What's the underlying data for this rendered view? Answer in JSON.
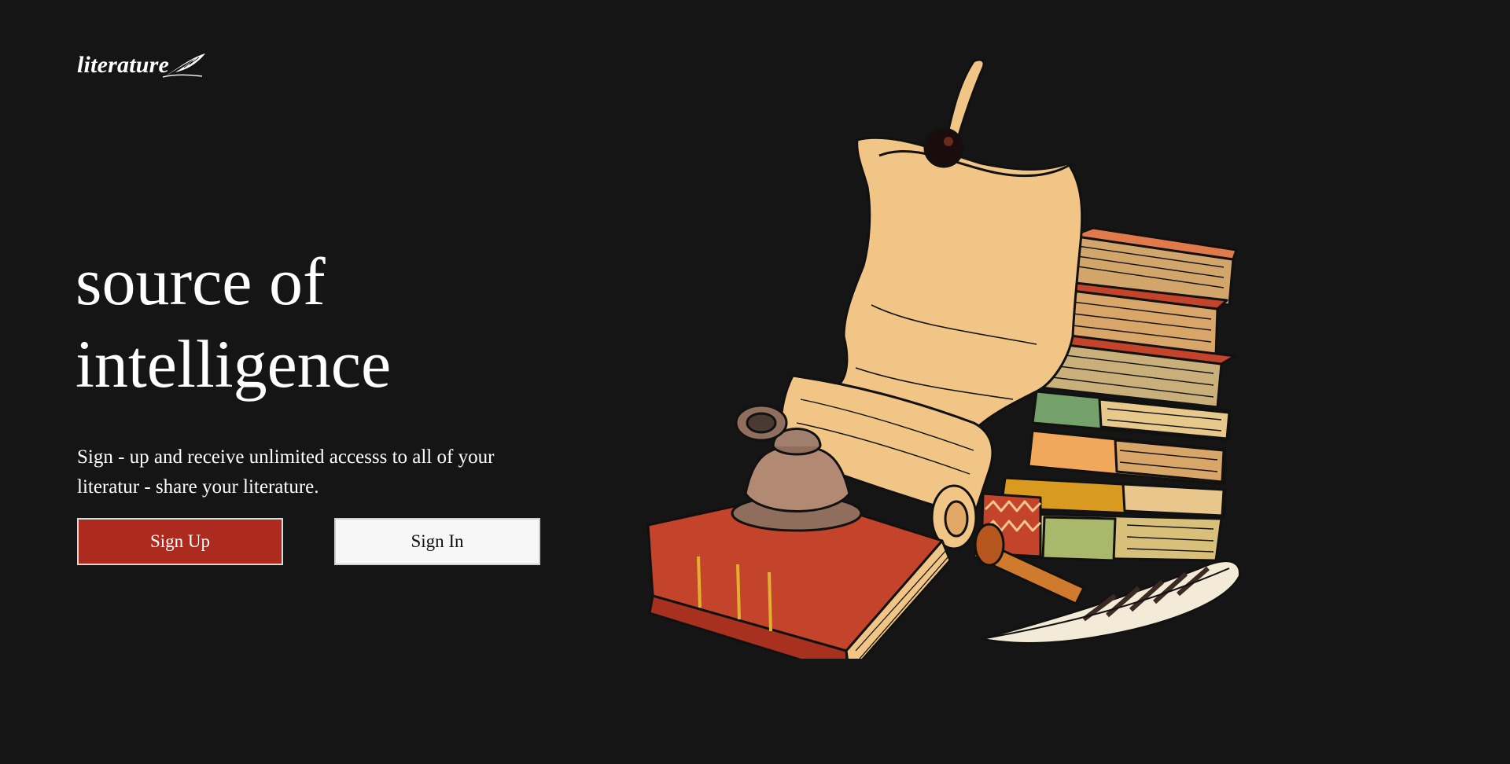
{
  "brand": {
    "logo_text": "literature",
    "logo_icon": "feather-icon"
  },
  "hero": {
    "headline_line1": "source of",
    "headline_line2": "intelligence",
    "subtext": "Sign - up and receive unlimited accesss to all of your literatur - share your literature."
  },
  "actions": {
    "signup_label": "Sign Up",
    "signin_label": "Sign In"
  },
  "illustration": {
    "subject": "books-scroll-inkwell-quill-illustration"
  },
  "colors": {
    "background": "#151515",
    "accent": "#ac2a1e",
    "secondary_button": "#f7f7f7",
    "parchment": "#f0c585"
  }
}
